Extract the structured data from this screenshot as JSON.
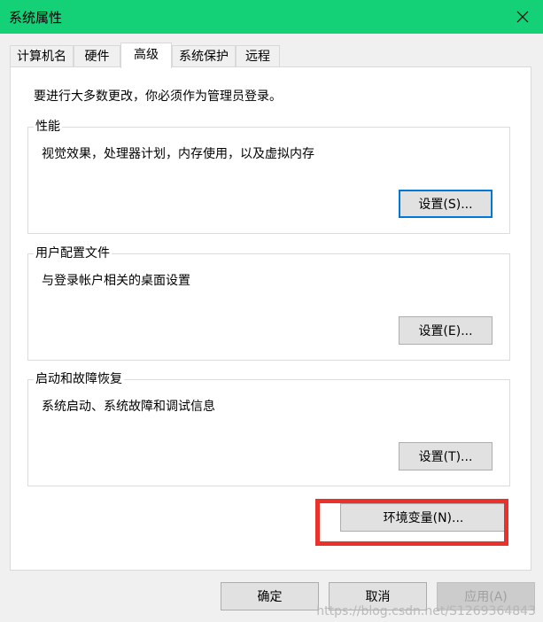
{
  "window": {
    "title": "系统属性"
  },
  "tabs": [
    {
      "label": "计算机名"
    },
    {
      "label": "硬件"
    },
    {
      "label": "高级",
      "active": true
    },
    {
      "label": "系统保护"
    },
    {
      "label": "远程"
    }
  ],
  "advanced": {
    "admin_note": "要进行大多数更改，你必须作为管理员登录。",
    "performance": {
      "legend": "性能",
      "description": "视觉效果，处理器计划，内存使用，以及虚拟内存",
      "button_label": "设置(S)..."
    },
    "user_profiles": {
      "legend": "用户配置文件",
      "description": "与登录帐户相关的桌面设置",
      "button_label": "设置(E)..."
    },
    "startup_recovery": {
      "legend": "启动和故障恢复",
      "description": "系统启动、系统故障和调试信息",
      "button_label": "设置(T)..."
    },
    "env_button_label": "环境变量(N)..."
  },
  "footer": {
    "ok_label": "确定",
    "cancel_label": "取消",
    "apply_label": "应用(A)"
  },
  "watermark": "https://blog.csdn.net/S1269364843",
  "colors": {
    "titlebar": "#14d178",
    "highlight": "#e8322b",
    "focus": "#0078d7"
  }
}
